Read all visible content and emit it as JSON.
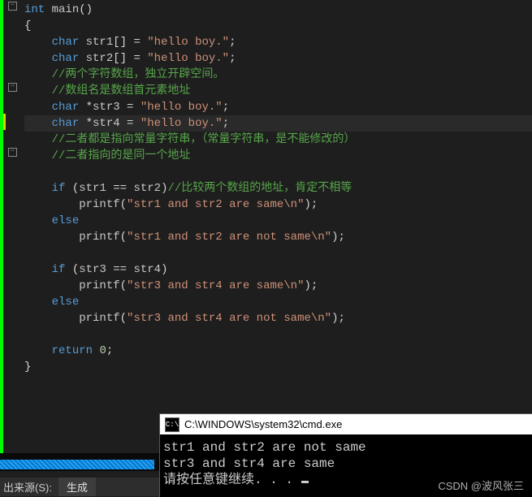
{
  "code": {
    "kw_int": "int",
    "fn_main": "main",
    "kw_char": "char",
    "kw_if": "if",
    "kw_else": "else",
    "kw_return": "return",
    "printf": "printf",
    "var_str1": "str1",
    "var_str2": "str2",
    "var_str3": "str3",
    "var_str4": "str4",
    "arr_brackets": "[]",
    "star": "*",
    "eq": " = ",
    "eqeq": " == ",
    "semi": ";",
    "lit_hello": "\"hello boy.\"",
    "cmt1": "//两个字符数组，独立开辟空间。",
    "cmt2": "//数组名是数组首元素地址",
    "cmt3": "//二者都是指向常量字符串，（常量字符串，是不能修改的）",
    "cmt4": "//二者指向的是同一个地址",
    "cmt5": "//比较两个数组的地址，肯定不相等",
    "pf1": "\"str1 and str2 are same\\n\"",
    "pf2": "\"str1 and str2 are not same\\n\"",
    "pf3": "\"str3 and str4 are same\\n\"",
    "pf4": "\"str3 and str4 are not same\\n\"",
    "zero": "0"
  },
  "console": {
    "title": "C:\\WINDOWS\\system32\\cmd.exe",
    "icon": "C:\\",
    "line1": "str1 and str2 are not same",
    "line2": "str3 and str4 are same",
    "line3": "请按任意键继续. . . "
  },
  "bottom": {
    "label": "出来源(S):",
    "select": "生成"
  },
  "watermark": "CSDN @波风张三"
}
